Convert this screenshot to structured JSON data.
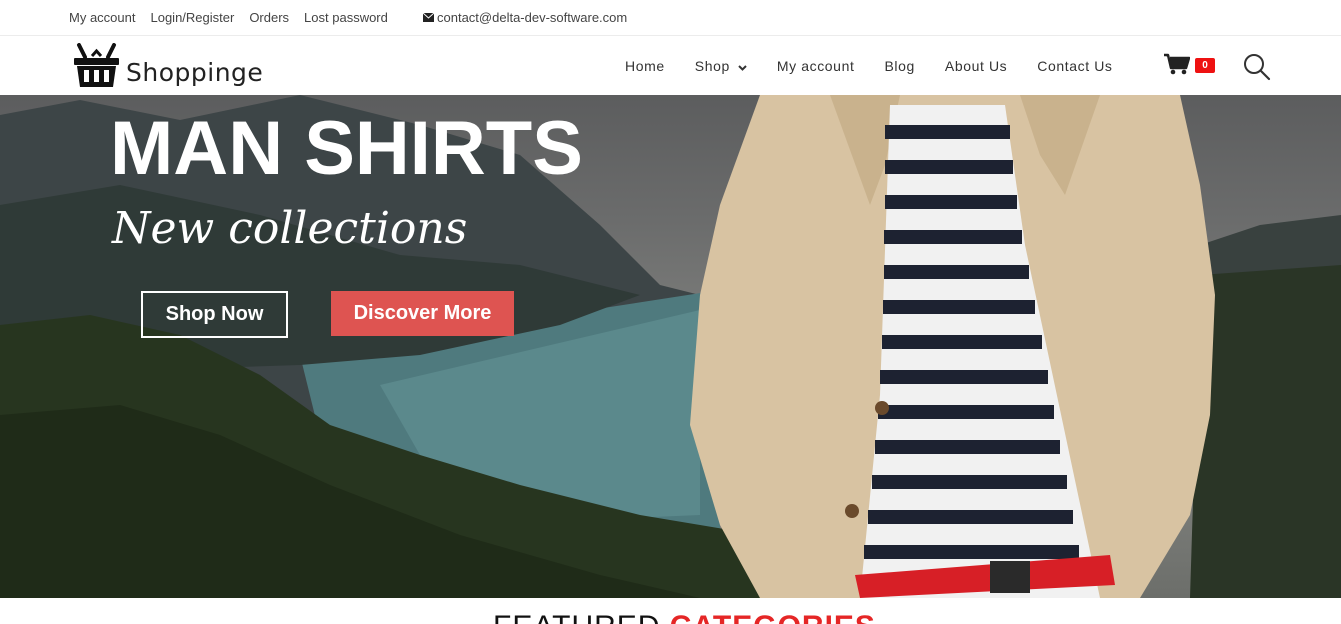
{
  "topbar": {
    "links": [
      "My account",
      "Login/Register",
      "Orders",
      "Lost password"
    ],
    "email": "contact@delta-dev-software.com"
  },
  "header": {
    "logo_text": "Shoppinge",
    "nav": [
      "Home",
      "Shop",
      "My account",
      "Blog",
      "About Us",
      "Contact Us"
    ],
    "cart_count": "0"
  },
  "hero": {
    "title": "MAN SHIRTS",
    "subtitle": "New collections",
    "shop_now": "Shop Now",
    "discover_more": "Discover More"
  },
  "featured": {
    "word1": "FEATURED",
    "word2": "CATEGORIES"
  },
  "colors": {
    "accent": "#de5451",
    "badge": "#e11111",
    "featured_red": "#e52626"
  }
}
